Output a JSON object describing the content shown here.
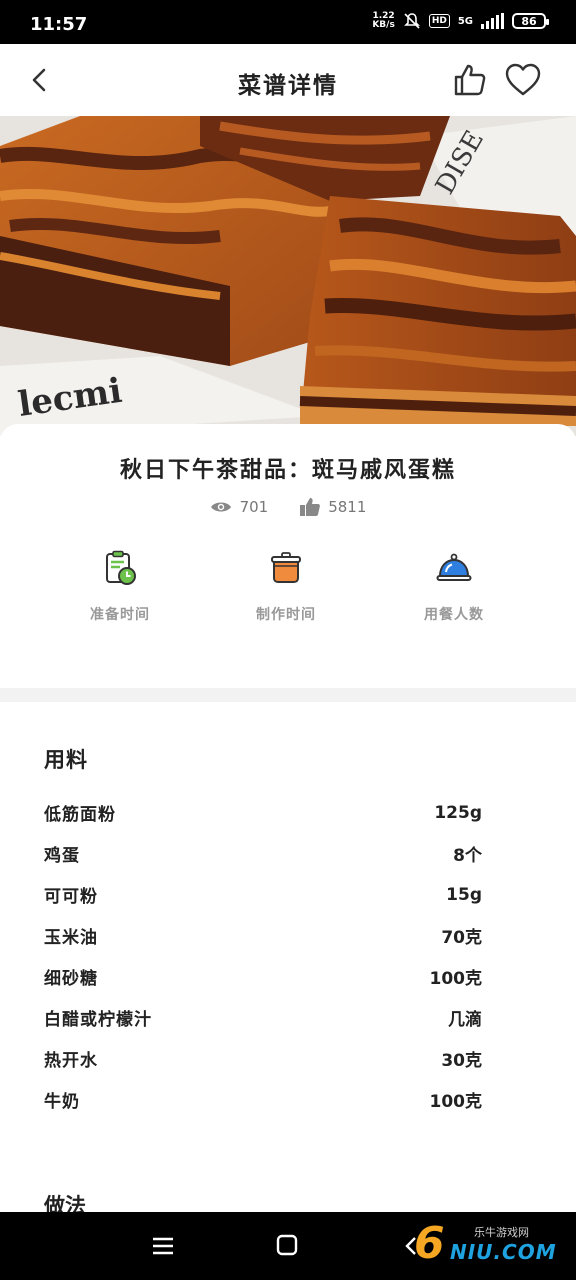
{
  "status_bar": {
    "time": "11:57",
    "net_speed_value": "1.22",
    "net_speed_unit": "KB/s",
    "hd_badge": "HD",
    "network_type": "5G",
    "battery": "86"
  },
  "header": {
    "title": "菜谱详情",
    "back_icon": "chevron-left-icon",
    "like_icon": "thumbs-up-icon",
    "favorite_icon": "heart-icon"
  },
  "recipe": {
    "title": "秋日下午茶甜品：斑马戚风蛋糕",
    "views": "701",
    "likes": "5811"
  },
  "meta": [
    {
      "label": "准备时间",
      "icon": "clipboard-timer-icon"
    },
    {
      "label": "制作时间",
      "icon": "cooking-pot-icon"
    },
    {
      "label": "用餐人数",
      "icon": "serving-cloche-icon"
    }
  ],
  "ingredients": {
    "title": "用料",
    "items": [
      {
        "name": "低筋面粉",
        "amount": "125g"
      },
      {
        "name": "鸡蛋",
        "amount": "8个"
      },
      {
        "name": "可可粉",
        "amount": "15g"
      },
      {
        "name": "玉米油",
        "amount": "70克"
      },
      {
        "name": "细砂糖",
        "amount": "100克"
      },
      {
        "name": "白醋或柠檬汁",
        "amount": "几滴"
      },
      {
        "name": "热开水",
        "amount": "30克"
      },
      {
        "name": "牛奶",
        "amount": "100克"
      }
    ]
  },
  "steps": {
    "title": "做法"
  },
  "watermark": {
    "digit": "6",
    "text_cn": "乐牛游戏网",
    "text_en": "NIU.COM"
  },
  "colors": {
    "accent_orange": "#f08a3c",
    "meta_green": "#6cc24a",
    "meta_blue": "#2f7fe0",
    "section_bg": "#f2f2f2"
  }
}
